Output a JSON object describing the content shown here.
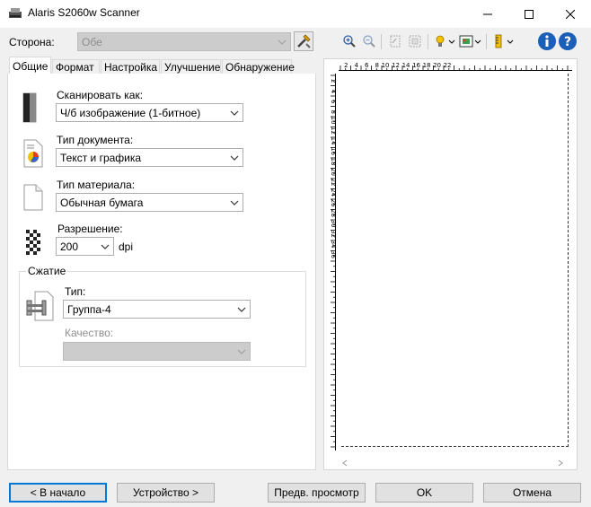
{
  "window": {
    "title": "Alaris S2060w Scanner",
    "controls": {
      "minimize": "—",
      "maximize": "☐",
      "close": "✕"
    }
  },
  "side": {
    "label": "Сторона:",
    "value": "Обе"
  },
  "tabs": [
    {
      "label": "Общие"
    },
    {
      "label": "Формат"
    },
    {
      "label": "Настройка"
    },
    {
      "label": "Улучшение"
    },
    {
      "label": "Обнаружение"
    }
  ],
  "general": {
    "scan_as": {
      "label": "Сканировать как:",
      "value": "Ч/б изображение (1-битное)"
    },
    "document_type": {
      "label": "Тип документа:",
      "value": "Текст и графика"
    },
    "media_type": {
      "label": "Тип материала:",
      "value": "Обычная бумага"
    },
    "resolution": {
      "label": "Разрешение:",
      "value": "200",
      "unit": "dpi"
    },
    "compression": {
      "group_label": "Сжатие",
      "type": {
        "label": "Тип:",
        "value": "Группа-4"
      },
      "quality": {
        "label": "Качество:",
        "value": ""
      }
    }
  },
  "ruler": {
    "top_ticks": [
      "2",
      "4",
      "6",
      "8",
      "10",
      "12",
      "14",
      "16",
      "18",
      "20",
      "22"
    ],
    "left_ticks": [
      "2",
      "4",
      "6",
      "8",
      "10",
      "12",
      "14",
      "16",
      "18",
      "20",
      "22",
      "24",
      "26",
      "28",
      "30",
      "32",
      "34",
      "36"
    ]
  },
  "buttons": {
    "home": "< В начало",
    "device": "Устройство >",
    "preview": "Предв. просмотр",
    "ok": "OK",
    "cancel": "Отмена"
  },
  "colors": {
    "accent": "#0078d7",
    "info_icon": "#1c5fb8"
  }
}
